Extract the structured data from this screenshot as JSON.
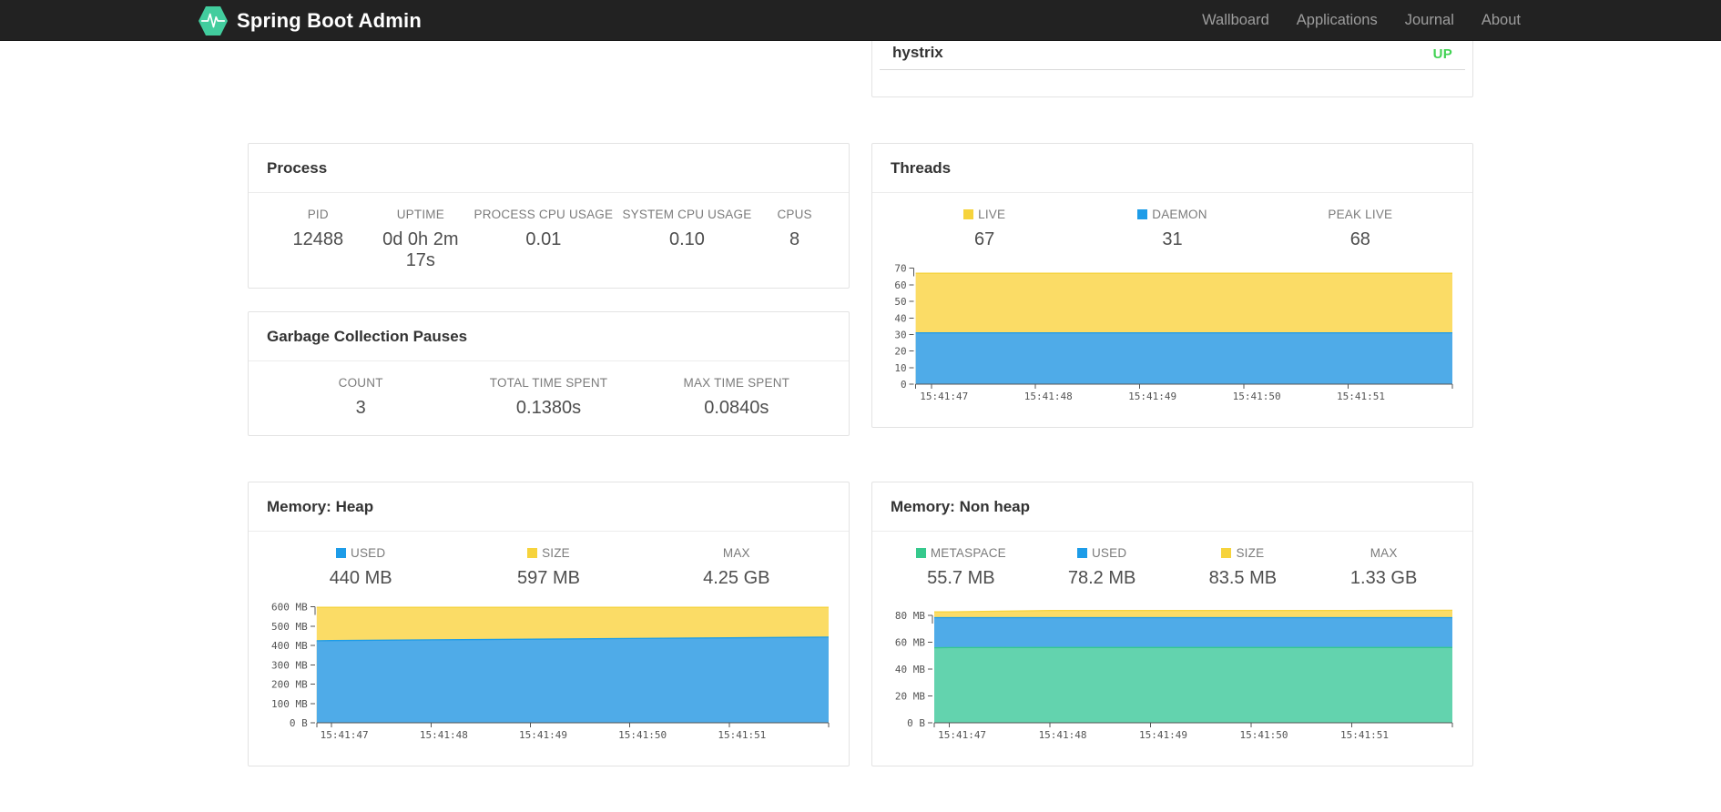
{
  "navbar": {
    "brand": "Spring Boot Admin",
    "links": [
      {
        "label": "Wallboard"
      },
      {
        "label": "Applications"
      },
      {
        "label": "Journal"
      },
      {
        "label": "About"
      }
    ]
  },
  "application_row": {
    "name": "hystrix",
    "status": "UP",
    "status_color": "#41d253"
  },
  "cards": {
    "process": {
      "title": "Process",
      "stats": [
        {
          "label": "PID",
          "value": "12488"
        },
        {
          "label": "UPTIME",
          "value": "0d 0h 2m 17s"
        },
        {
          "label": "PROCESS CPU USAGE",
          "value": "0.01"
        },
        {
          "label": "SYSTEM CPU USAGE",
          "value": "0.10"
        },
        {
          "label": "CPUS",
          "value": "8"
        }
      ]
    },
    "gc": {
      "title": "Garbage Collection Pauses",
      "stats": [
        {
          "label": "COUNT",
          "value": "3"
        },
        {
          "label": "TOTAL TIME SPENT",
          "value": "0.1380s"
        },
        {
          "label": "MAX TIME SPENT",
          "value": "0.0840s"
        }
      ]
    },
    "threads": {
      "title": "Threads",
      "stats": [
        {
          "label": "LIVE",
          "value": "67",
          "color": "#f6d33c"
        },
        {
          "label": "DAEMON",
          "value": "31",
          "color": "#1d9ce8"
        },
        {
          "label": "PEAK LIVE",
          "value": "68"
        }
      ]
    },
    "heap": {
      "title": "Memory: Heap",
      "stats": [
        {
          "label": "USED",
          "value": "440 MB",
          "color": "#1d9ce8"
        },
        {
          "label": "SIZE",
          "value": "597 MB",
          "color": "#f6d33c"
        },
        {
          "label": "MAX",
          "value": "4.25 GB"
        }
      ]
    },
    "nonheap": {
      "title": "Memory: Non heap",
      "stats": [
        {
          "label": "METASPACE",
          "value": "55.7 MB",
          "color": "#36c98d"
        },
        {
          "label": "USED",
          "value": "78.2 MB",
          "color": "#1d9ce8"
        },
        {
          "label": "SIZE",
          "value": "83.5 MB",
          "color": "#f6d33c"
        },
        {
          "label": "MAX",
          "value": "1.33 GB"
        }
      ]
    }
  },
  "chart_data": [
    {
      "id": "threads",
      "type": "area",
      "title": "Threads",
      "stacked": true,
      "x_labels": [
        "15:41:47",
        "15:41:48",
        "15:41:49",
        "15:41:50",
        "15:41:51"
      ],
      "x_tick_values": [
        0,
        1,
        2,
        3,
        4
      ],
      "x_range": [
        -0.15,
        5.0
      ],
      "x": [
        -0.15,
        0,
        1,
        2,
        3,
        4,
        5.0
      ],
      "ylim": [
        0,
        71.5
      ],
      "y_ticks": [
        {
          "v": 70,
          "label": "70"
        },
        {
          "v": 60,
          "label": "60"
        },
        {
          "v": 50,
          "label": "50"
        },
        {
          "v": 40,
          "label": "40"
        },
        {
          "v": 30,
          "label": "30"
        },
        {
          "v": 20,
          "label": "20"
        },
        {
          "v": 10,
          "label": "10"
        },
        {
          "v": 0,
          "label": "0"
        }
      ],
      "series": [
        {
          "name": "DAEMON",
          "color": "#4fabe8",
          "line": "#1d9ce8",
          "values": [
            31,
            31,
            31,
            31,
            31,
            31,
            31
          ]
        },
        {
          "name": "LIVE",
          "color": "#fbdc66",
          "line": "#f6d33c",
          "values": [
            67,
            67,
            67,
            67,
            67,
            67,
            67
          ]
        }
      ]
    },
    {
      "id": "memory-heap",
      "type": "area",
      "title": "Memory: Heap",
      "stacked": true,
      "x_labels": [
        "15:41:47",
        "15:41:48",
        "15:41:49",
        "15:41:50",
        "15:41:51"
      ],
      "x_tick_values": [
        0,
        1,
        2,
        3,
        4
      ],
      "x_range": [
        -0.15,
        5.0
      ],
      "x": [
        -0.15,
        0,
        1,
        2,
        3,
        4,
        5.0
      ],
      "ylim": [
        0,
        612
      ],
      "y_ticks": [
        {
          "v": 600,
          "label": "600 MB"
        },
        {
          "v": 500,
          "label": "500 MB"
        },
        {
          "v": 400,
          "label": "400 MB"
        },
        {
          "v": 300,
          "label": "300 MB"
        },
        {
          "v": 200,
          "label": "200 MB"
        },
        {
          "v": 100,
          "label": "100 MB"
        },
        {
          "v": 0,
          "label": "0 B"
        }
      ],
      "series": [
        {
          "name": "USED",
          "color": "#4fabe8",
          "line": "#1d9ce8",
          "values": [
            424,
            425,
            429,
            432,
            436,
            439,
            443
          ]
        },
        {
          "name": "SIZE",
          "color": "#fbdc66",
          "line": "#f6d33c",
          "values": [
            597,
            597,
            597,
            597,
            597,
            597,
            597
          ]
        }
      ]
    },
    {
      "id": "memory-nonheap",
      "type": "area",
      "title": "Memory: Non heap",
      "stacked": true,
      "x_labels": [
        "15:41:47",
        "15:41:48",
        "15:41:49",
        "15:41:50",
        "15:41:51"
      ],
      "x_tick_values": [
        0,
        1,
        2,
        3,
        4
      ],
      "x_range": [
        -0.15,
        5.0
      ],
      "x": [
        -0.15,
        0,
        1,
        2,
        3,
        4,
        5.0
      ],
      "ylim": [
        0,
        88
      ],
      "y_ticks": [
        {
          "v": 80,
          "label": "80 MB"
        },
        {
          "v": 60,
          "label": "60 MB"
        },
        {
          "v": 40,
          "label": "40 MB"
        },
        {
          "v": 20,
          "label": "20 MB"
        },
        {
          "v": 0,
          "label": "0 B"
        }
      ],
      "series": [
        {
          "name": "METASPACE",
          "color": "#63d3ae",
          "line": "#36c98d",
          "values": [
            55.8,
            55.9,
            56,
            56,
            56,
            56,
            56
          ]
        },
        {
          "name": "USED",
          "color": "#4fabe8",
          "line": "#1d9ce8",
          "values": [
            78.2,
            78.2,
            78.2,
            78.2,
            78.2,
            78.2,
            78.2
          ]
        },
        {
          "name": "SIZE",
          "color": "#fbdc66",
          "line": "#f6d33c",
          "values": [
            82.5,
            82.5,
            83.5,
            83.5,
            83.5,
            83.5,
            83.7
          ]
        }
      ]
    }
  ]
}
